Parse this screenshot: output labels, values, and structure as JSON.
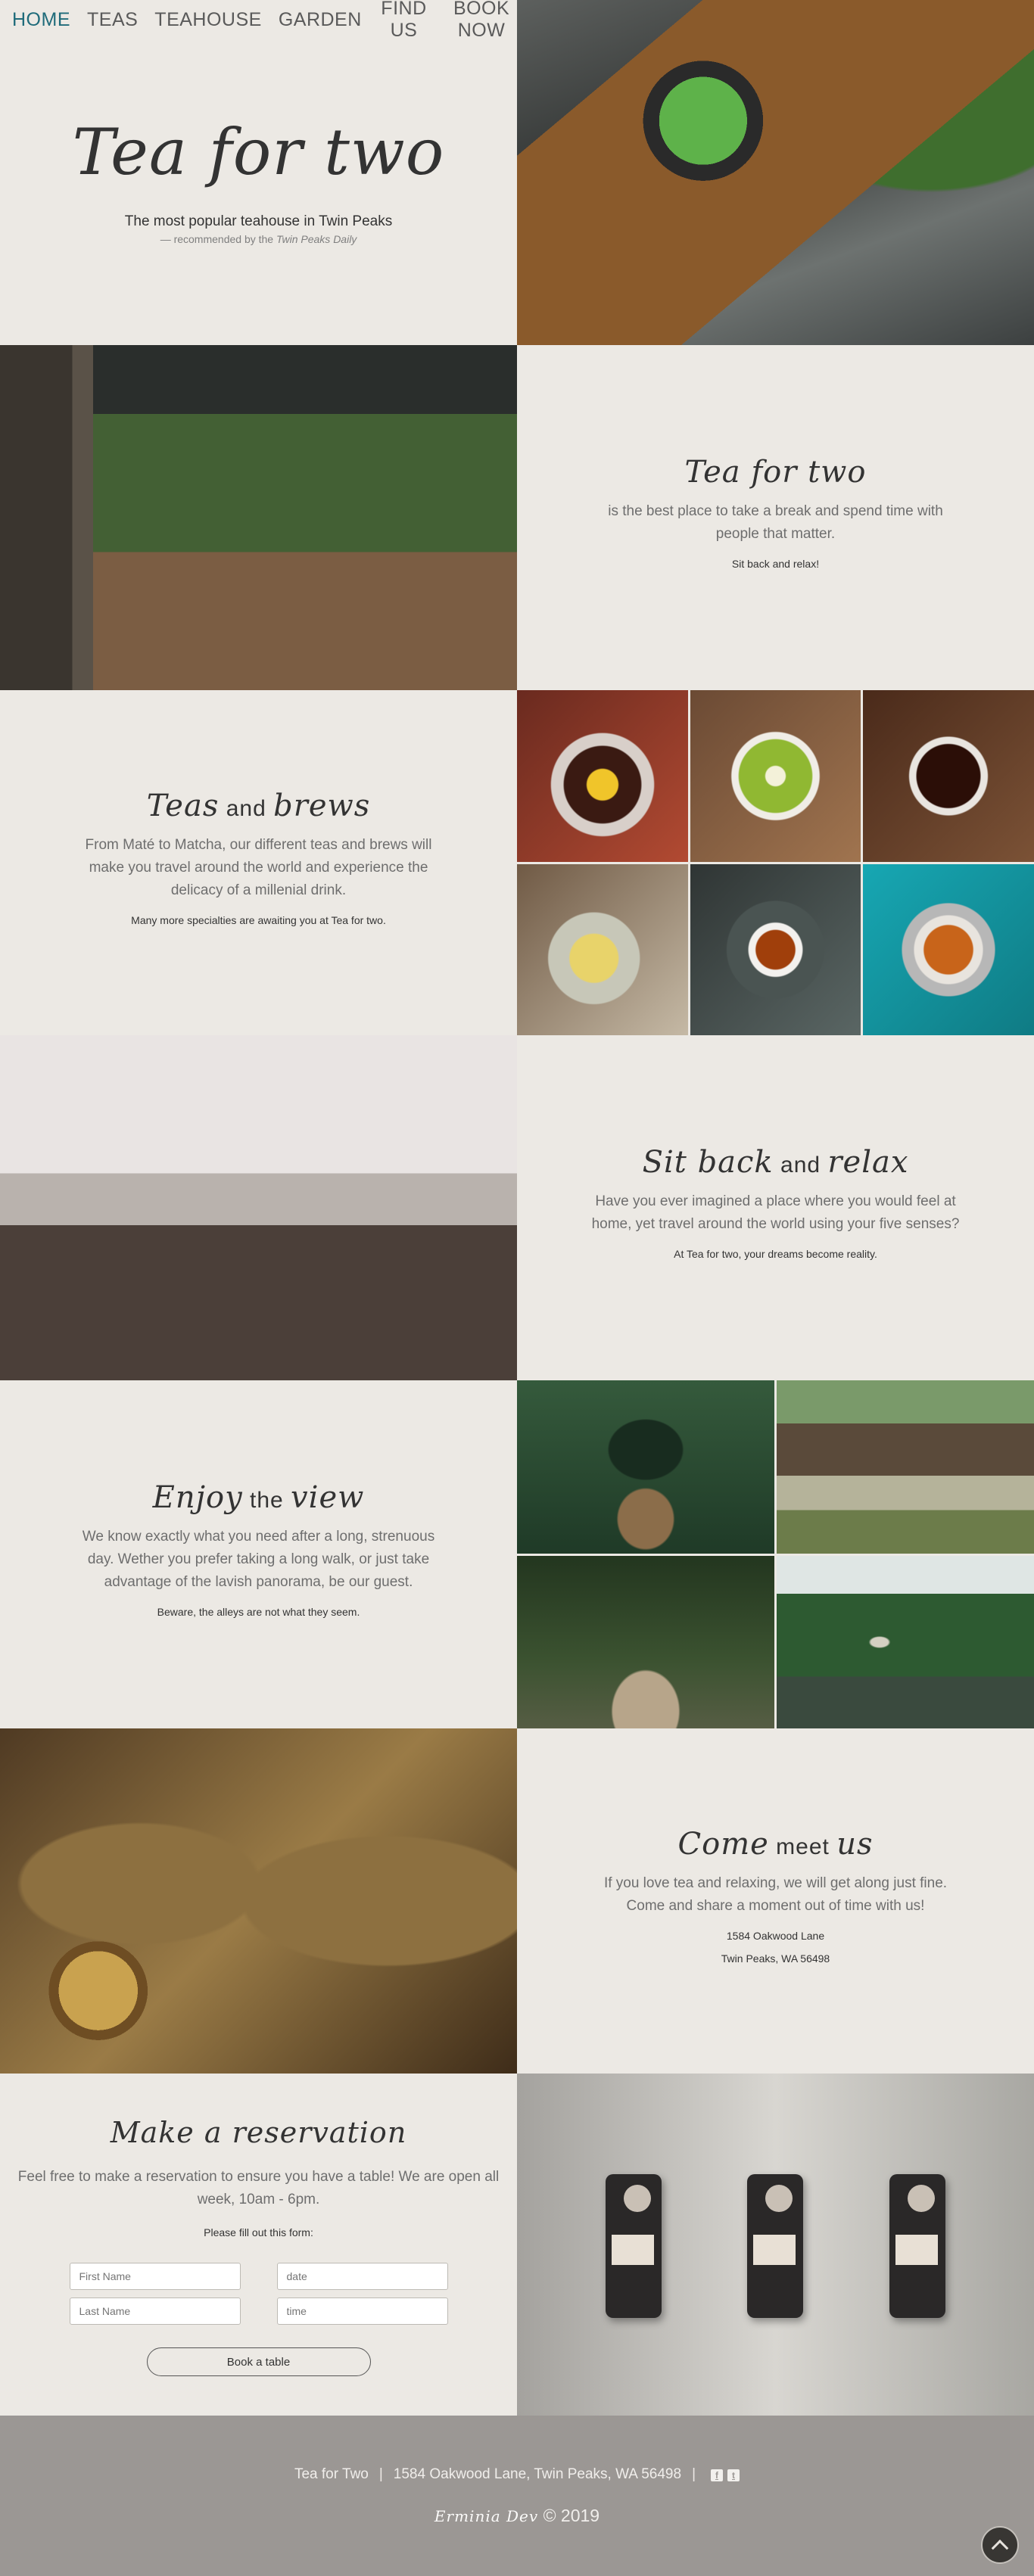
{
  "nav": {
    "items": [
      "HOME",
      "TEAS",
      "TEAHOUSE",
      "GARDEN",
      "FIND US",
      "BOOK NOW"
    ],
    "active": "HOME"
  },
  "hero": {
    "title": "Tea for two",
    "subtitle": "The most popular teahouse in Twin Peaks",
    "rec_prefix": "— recommended by the ",
    "rec_source": "Twin Peaks Daily"
  },
  "about": {
    "title": "Tea for two",
    "text": "is the best place to take a break and spend time with people that matter.",
    "note": "Sit back and relax!"
  },
  "teas": {
    "title_script": "Teas",
    "title_and": " and ",
    "title_script2": "brews",
    "text": "From Maté to Matcha, our different teas and brews will make you travel around the world and experience the delicacy of a millenial drink.",
    "note": "Many more specialties are awaiting you at Tea for two."
  },
  "relax": {
    "title_script": "Sit back",
    "title_and": " and ",
    "title_script2": "relax",
    "text": "Have you ever imagined a place where you would feel at home, yet travel around the world using your five senses?",
    "note": "At Tea for two, your dreams become reality."
  },
  "view": {
    "title_script": "Enjoy",
    "title_and": " the ",
    "title_script2": "view",
    "text": "We know exactly what you need after a long, strenuous day. Wether you prefer taking a long walk, or just take advantage of the lavish panorama, be our guest.",
    "note": "Beware, the alleys are not what they seem."
  },
  "visit": {
    "title_script": "Come",
    "title_and": " meet ",
    "title_script2": "us",
    "text": "If you love tea and relaxing, we will get along just fine. Come and share a moment out of time with us!",
    "address1": "1584 Oakwood Lane",
    "address2": "Twin Peaks, WA 56498"
  },
  "reservation": {
    "title": "Make a reservation",
    "text": "Feel free to make a reservation to ensure you have a table! We are open all week, 10am - 6pm.",
    "note": "Please fill out this form:",
    "first_name_placeholder": "First Name",
    "date_placeholder": "date",
    "last_name_placeholder": "Last Name",
    "time_placeholder": "time",
    "button": "Book a table"
  },
  "footer": {
    "name": "Tea for Two",
    "address": "1584 Oakwood Lane, Twin Peaks, WA 56498",
    "sep": "|",
    "author": "Erminia Dev",
    "copyright": "© 2019",
    "facebook_icon": "f",
    "twitter_icon": "t"
  },
  "colors": {
    "background": "#ece9e4",
    "accent_nav": "#1f6b7a",
    "footer": "#9b9794"
  }
}
